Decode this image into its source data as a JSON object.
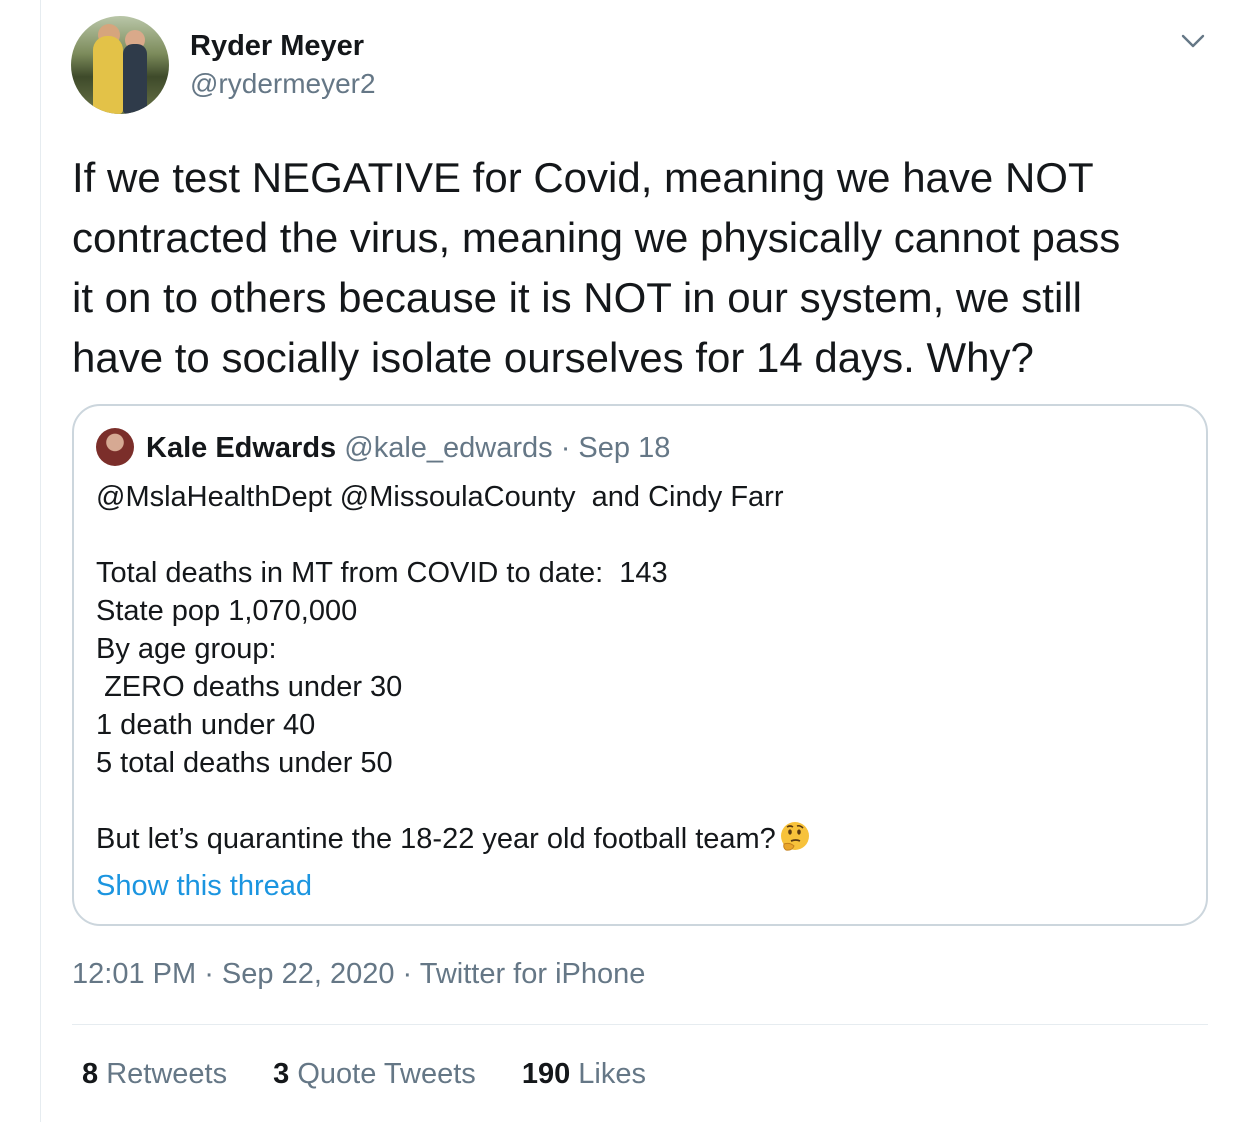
{
  "author": {
    "name": "Ryder Meyer",
    "handle": "@rydermeyer2"
  },
  "tweet": {
    "text": "If we test NEGATIVE for Covid, meaning we have NOT\ncontracted the virus, meaning we physically cannot pass\nit on to others because it is NOT in our system, we still\nhave to socially isolate ourselves for 14 days. Why?"
  },
  "quoted": {
    "name": "Kale Edwards",
    "handle": "@kale_edwards",
    "separator": " · ",
    "date": "Sep 18",
    "body": "@MslaHealthDept @MissoulaCounty  and Cindy Farr\n\nTotal deaths in MT from COVID to date:  143\nState pop 1,070,000\nBy age group:\n ZERO deaths under 30\n1 death under 40\n5 total deaths under 50\n\nBut let’s quarantine the 18-22 year old football team?",
    "emoji": "thinking-face",
    "show_thread": "Show this thread"
  },
  "meta": {
    "time": "12:01 PM",
    "date": "Sep 22, 2020",
    "source": "Twitter for iPhone",
    "separator": " · "
  },
  "stats": {
    "retweets": {
      "count": "8",
      "label": "Retweets"
    },
    "quotes": {
      "count": "3",
      "label": "Quote Tweets"
    },
    "likes": {
      "count": "190",
      "label": "Likes"
    }
  },
  "colors": {
    "text_primary": "#14171a",
    "text_secondary": "#657786",
    "link": "#1b95e0",
    "border": "#ccd6dd"
  }
}
